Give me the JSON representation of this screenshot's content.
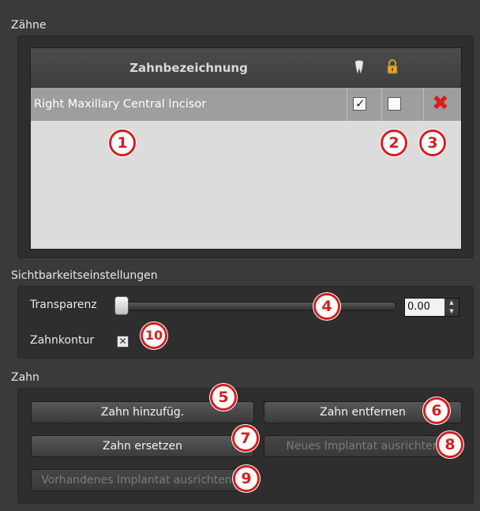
{
  "zaehne": {
    "title": "Zähne",
    "table": {
      "header_name": "Zahnbezeichnung",
      "header_icons": [
        "tooth-icon",
        "lock-icon"
      ],
      "rows": [
        {
          "name": "Right Maxillary Central Incisor",
          "visible": true,
          "locked": false
        }
      ]
    }
  },
  "sicht": {
    "title": "Sichtbarkeitseinstellungen",
    "transparency_label": "Transparenz",
    "transparency_value": "0.00",
    "kontur_label": "Zahnkontur"
  },
  "zahn": {
    "title": "Zahn",
    "add_label": "Zahn hinzufüg.",
    "remove_label": "Zahn entfernen",
    "replace_label": "Zahn ersetzen",
    "align_new_label": "Neues Implantat ausrichten",
    "align_existing_label": "Vorhandenes Implantat ausrichten"
  },
  "badges": [
    "1",
    "2",
    "3",
    "4",
    "5",
    "6",
    "7",
    "8",
    "9",
    "10"
  ],
  "colors": {
    "badge": "#d41f1f",
    "delete": "#d81e1e",
    "panel": "#2e2e2e",
    "row_selected": "#9e9e9e"
  }
}
